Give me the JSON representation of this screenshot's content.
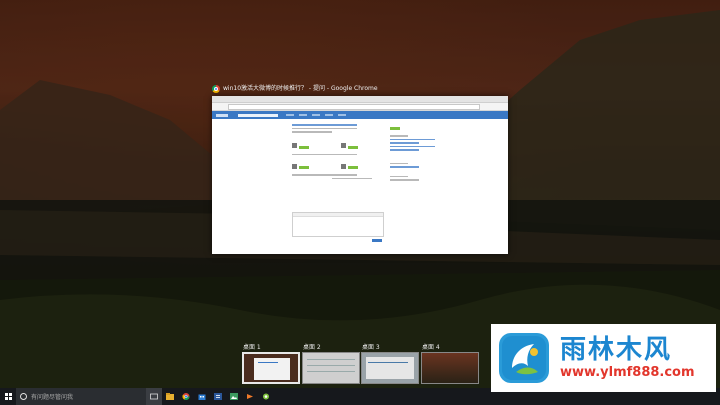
{
  "window": {
    "caption": "win10激活大微博的时候推行？ - 提问 - Google Chrome"
  },
  "desktops": [
    {
      "label": "桌面 1",
      "active": true
    },
    {
      "label": "桌面 2",
      "active": false
    },
    {
      "label": "桌面 3",
      "active": false
    },
    {
      "label": "桌面 4",
      "active": false
    }
  ],
  "taskbar": {
    "search_placeholder": "有问题尽管问我",
    "icons": [
      "task-view-icon",
      "file-explorer-icon",
      "chrome-icon",
      "store-icon",
      "word-icon",
      "image-viewer-icon",
      "media-player-icon",
      "tool-icon"
    ]
  },
  "watermark": {
    "title": "雨林木风",
    "url": "www.ylmf888.com"
  },
  "colors": {
    "accent": "#3a78c4",
    "watermark_blue": "#1c86d0",
    "watermark_red": "#e2362c"
  }
}
